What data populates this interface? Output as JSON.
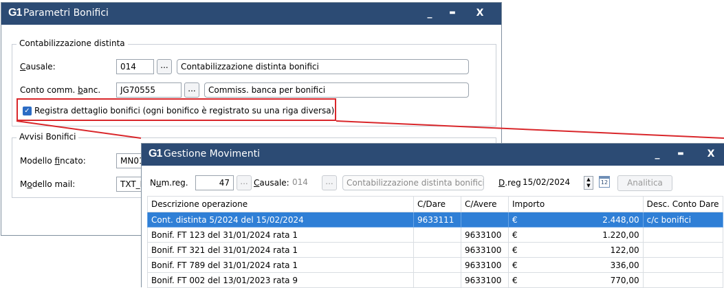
{
  "param_window": {
    "title": "Parametri Bonifici",
    "logo": "G1",
    "minimize_icon": "minimize-icon",
    "maximize_icon": "maximize-icon",
    "close_icon": "close-icon",
    "minimize_glyph": "_",
    "maximize_glyph": "▬",
    "close_glyph": "X",
    "group1": {
      "legend": "Contabilizzazione distinta",
      "causale_label_u": "C",
      "causale_label_rest": "ausale:",
      "causale_code": "014",
      "causale_desc": "Contabilizzazione distinta bonifici",
      "conto_label_pre": "Conto comm. ",
      "conto_label_u": "b",
      "conto_label_rest": "anc.",
      "conto_code": "JG70555",
      "conto_desc": "Commiss. banca per bonifici",
      "lookup_label": "...",
      "checkbox_label": "Registra dettaglio bonifici (ogni bonifico è registrato su una riga diversa)",
      "checkbox_checked": true
    },
    "group2": {
      "legend": "Avvisi Bonifici",
      "modello_fincato_pre": "Modello ",
      "modello_fincato_u": "f",
      "modello_fincato_rest": "incato:",
      "modello_fincato_value": "MN01",
      "modello_mail_pre": "M",
      "modello_mail_u": "o",
      "modello_mail_rest": "dello mail:",
      "modello_mail_value": "TXT_N"
    }
  },
  "movimenti_window": {
    "title": "Gestione Movimenti",
    "logo": "G1",
    "minimize_glyph": "_",
    "maximize_glyph": "▬",
    "close_glyph": "X",
    "toolbar": {
      "numreg_label_pre": "N",
      "numreg_label_u": "u",
      "numreg_label_rest": "m.reg.",
      "numreg_value": "47",
      "causale_label_u": "C",
      "causale_label_rest": "ausale:",
      "causale_value": "014",
      "causale_desc": "Contabilizzazione distinta bonifici",
      "dreg_label_u": "D",
      "dreg_label_rest": ".reg.",
      "dreg_value": "15/02/2024",
      "analitica_label": "Analitica",
      "lookup_label": "...",
      "spinner_icon": "spinner-icon",
      "calendar_icon": "calendar-icon",
      "calendar_glyph": "12"
    },
    "table": {
      "columns": [
        "Descrizione operazione",
        "C/Dare",
        "C/Avere",
        "Importo",
        "Desc. Conto Dare"
      ],
      "rows": [
        {
          "desc": "Cont. distinta 5/2024 del 15/02/2024",
          "dare": "9633111",
          "avere": "",
          "cur": "€",
          "importo": "2.448,00",
          "desc_conto": "c/c bonifici"
        },
        {
          "desc": "Bonif. FT 123 del 31/01/2024 rata 1",
          "dare": "",
          "avere": "9633100",
          "cur": "€",
          "importo": "1.220,00",
          "desc_conto": ""
        },
        {
          "desc": "Bonif. FT 321 del 31/01/2024 rata 1",
          "dare": "",
          "avere": "9633100",
          "cur": "€",
          "importo": "122,00",
          "desc_conto": ""
        },
        {
          "desc": "Bonif. FT 789 del 31/01/2024 rata 1",
          "dare": "",
          "avere": "9633100",
          "cur": "€",
          "importo": "336,00",
          "desc_conto": ""
        },
        {
          "desc": "Bonif. FT 002 del 13/01/2023 rata 9",
          "dare": "",
          "avere": "9633100",
          "cur": "€",
          "importo": "770,00",
          "desc_conto": ""
        }
      ]
    }
  },
  "colors": {
    "titlebar": "#2c4b74",
    "selection": "#2f7fd6",
    "highlight": "#d9262a"
  }
}
